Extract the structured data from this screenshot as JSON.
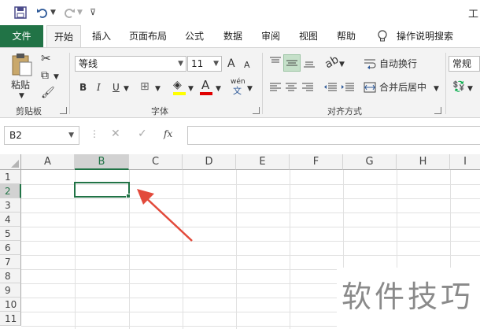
{
  "title_fragment": "工",
  "qat": {
    "save_icon": "save-icon",
    "undo_icon": "undo-icon",
    "redo_icon": "redo-icon",
    "customize_icon": "customize-qat-icon"
  },
  "tabs": [
    {
      "label": "文件"
    },
    {
      "label": "开始"
    },
    {
      "label": "插入"
    },
    {
      "label": "页面布局"
    },
    {
      "label": "公式"
    },
    {
      "label": "数据"
    },
    {
      "label": "审阅"
    },
    {
      "label": "视图"
    },
    {
      "label": "帮助"
    },
    {
      "label": "操作说明搜索"
    }
  ],
  "clipboard": {
    "paste_label": "粘贴",
    "group_label": "剪贴板"
  },
  "font": {
    "name": "等线",
    "size": "11",
    "bold": "B",
    "italic": "I",
    "underline": "U",
    "group_label": "字体",
    "grow": "A",
    "shrink": "A",
    "color_a": "A",
    "wen": "wén",
    "wen_char": "文"
  },
  "alignment": {
    "wrap_label": "自动换行",
    "merge_label": "合并后居中",
    "group_label": "对齐方式"
  },
  "number": {
    "format": "常规"
  },
  "formula_bar": {
    "name_box": "B2",
    "fx": "fx"
  },
  "sheet": {
    "columns": [
      "A",
      "B",
      "C",
      "D",
      "E",
      "F",
      "G",
      "H",
      "I"
    ],
    "rows": [
      "1",
      "2",
      "3",
      "4",
      "5",
      "6",
      "7",
      "8",
      "9",
      "10",
      "11"
    ],
    "selected_cell": "B2"
  },
  "watermark": "软件技巧",
  "colors": {
    "accent": "#217346",
    "arrow": "#e24a3b"
  }
}
